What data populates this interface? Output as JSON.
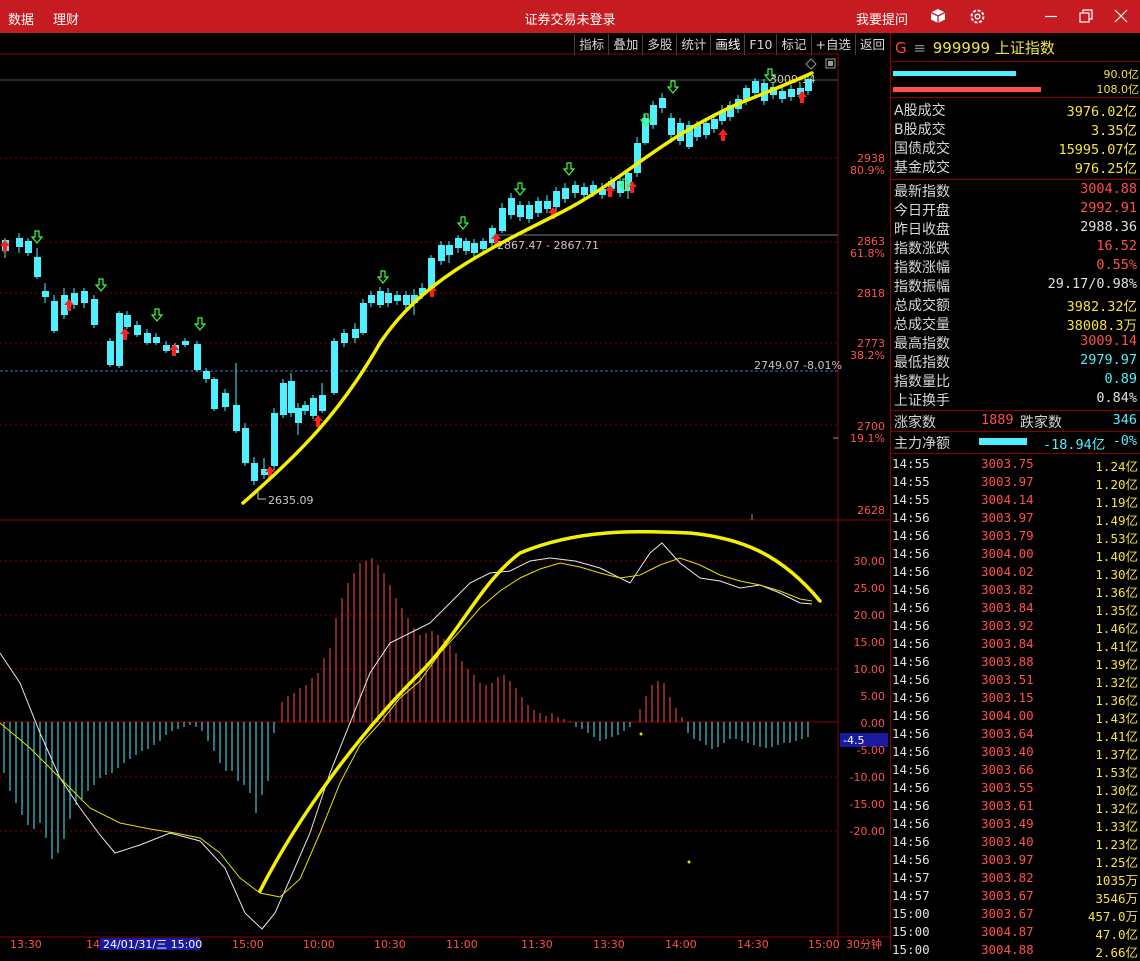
{
  "titlebar": {
    "menu": [
      "数据",
      "理财"
    ],
    "window_title": "证券交易未登录",
    "help_label": "我要提问",
    "icons": [
      "cube-icon",
      "gear-icon",
      "minimize-icon",
      "restore-icon",
      "close-icon"
    ]
  },
  "toolbar": [
    "指标",
    "叠加",
    "多股",
    "统计",
    "画线",
    "F10",
    "标记",
    "+自选",
    "返回"
  ],
  "chart": {
    "price_axis": [
      "2938",
      "80.9%",
      "2863",
      "61.8%",
      "2818",
      "2773",
      "38.2%",
      "2700",
      "19.1%",
      "2628"
    ],
    "macd_axis": [
      "30.00",
      "25.00",
      "20.00",
      "15.00",
      "10.00",
      "5.00",
      "0.00",
      "-4.5",
      "-5.00",
      "-10.00",
      "-15.00",
      "-20.00"
    ],
    "annotations": {
      "fib_range": "2867.47 - 2867.71",
      "fib_level": "2749.07 -8.01%",
      "low": "2635.09",
      "high": "3009.14"
    },
    "time_axis": [
      "13:30",
      "14",
      "24/01/31/三 15:00",
      "15:00",
      "10:00",
      "10:30",
      "11:00",
      "11:30",
      "13:30",
      "14:00",
      "14:30",
      "15:00",
      "30分钟"
    ],
    "colors": {
      "up": "#ff3c3c",
      "down": "#4ef0ff",
      "drawing": "#f5f000",
      "grid": "#8b0000"
    }
  },
  "panel": {
    "code": "999999",
    "name": "上证指数",
    "prefix": "G",
    "volume_bars": {
      "top": "90.0亿",
      "bottom": "108.0亿"
    },
    "rows1": [
      {
        "k": "A股成交",
        "v": "3976.02亿",
        "c": "#f5e342"
      },
      {
        "k": "B股成交",
        "v": "3.35亿",
        "c": "#f5e342"
      },
      {
        "k": "国债成交",
        "v": "15995.07亿",
        "c": "#f5e342"
      },
      {
        "k": "基金成交",
        "v": "976.25亿",
        "c": "#f5e342"
      }
    ],
    "rows2": [
      {
        "k": "最新指数",
        "v": "3004.88",
        "c": "#ff5050"
      },
      {
        "k": "今日开盘",
        "v": "2992.91",
        "c": "#ff5050"
      },
      {
        "k": "昨日收盘",
        "v": "2988.36",
        "c": "#e0e0e0"
      },
      {
        "k": "指数涨跌",
        "v": "16.52",
        "c": "#ff5050"
      },
      {
        "k": "指数涨幅",
        "v": "0.55%",
        "c": "#ff5050"
      },
      {
        "k": "指数振幅",
        "v": "29.17/0.98%",
        "c": "#e0e0e0"
      },
      {
        "k": "总成交额",
        "v": "3982.32亿",
        "c": "#f5e342"
      },
      {
        "k": "总成交量",
        "v": "38008.3万",
        "c": "#f5e342"
      },
      {
        "k": "最高指数",
        "v": "3009.14",
        "c": "#ff5050"
      },
      {
        "k": "最低指数",
        "v": "2979.97",
        "c": "#4ef0ff"
      },
      {
        "k": "指数量比",
        "v": "0.89",
        "c": "#4ef0ff"
      },
      {
        "k": "上证换手",
        "v": "0.84%",
        "c": "#e0e0e0"
      }
    ],
    "breadth": {
      "up_label": "涨家数",
      "up": "1889",
      "down_label": "跌家数",
      "down": "346"
    },
    "flow": {
      "label": "主力净额",
      "value": "-18.94亿",
      "pct": "-0%"
    },
    "ticks": [
      {
        "t": "14:55",
        "p": "3003.75",
        "v": "1.24亿"
      },
      {
        "t": "14:55",
        "p": "3003.97",
        "v": "1.20亿"
      },
      {
        "t": "14:55",
        "p": "3004.14",
        "v": "1.19亿"
      },
      {
        "t": "14:56",
        "p": "3003.97",
        "v": "1.49亿"
      },
      {
        "t": "14:56",
        "p": "3003.79",
        "v": "1.53亿"
      },
      {
        "t": "14:56",
        "p": "3004.00",
        "v": "1.40亿"
      },
      {
        "t": "14:56",
        "p": "3004.02",
        "v": "1.30亿"
      },
      {
        "t": "14:56",
        "p": "3003.82",
        "v": "1.36亿"
      },
      {
        "t": "14:56",
        "p": "3003.84",
        "v": "1.35亿"
      },
      {
        "t": "14:56",
        "p": "3003.92",
        "v": "1.46亿"
      },
      {
        "t": "14:56",
        "p": "3003.84",
        "v": "1.41亿"
      },
      {
        "t": "14:56",
        "p": "3003.88",
        "v": "1.39亿"
      },
      {
        "t": "14:56",
        "p": "3003.51",
        "v": "1.32亿"
      },
      {
        "t": "14:56",
        "p": "3003.15",
        "v": "1.36亿"
      },
      {
        "t": "14:56",
        "p": "3004.00",
        "v": "1.43亿"
      },
      {
        "t": "14:56",
        "p": "3003.64",
        "v": "1.41亿"
      },
      {
        "t": "14:56",
        "p": "3003.40",
        "v": "1.37亿"
      },
      {
        "t": "14:56",
        "p": "3003.66",
        "v": "1.53亿"
      },
      {
        "t": "14:56",
        "p": "3003.55",
        "v": "1.30亿"
      },
      {
        "t": "14:56",
        "p": "3003.61",
        "v": "1.32亿"
      },
      {
        "t": "14:56",
        "p": "3003.49",
        "v": "1.33亿"
      },
      {
        "t": "14:56",
        "p": "3003.40",
        "v": "1.23亿"
      },
      {
        "t": "14:56",
        "p": "3003.97",
        "v": "1.25亿"
      },
      {
        "t": "14:57",
        "p": "3003.82",
        "v": "1035万"
      },
      {
        "t": "14:57",
        "p": "3003.67",
        "v": "3546万"
      },
      {
        "t": "15:00",
        "p": "3003.67",
        "v": "457.0万"
      },
      {
        "t": "15:00",
        "p": "3004.87",
        "v": "47.0亿"
      },
      {
        "t": "15:00",
        "p": "3004.88",
        "v": "2.66亿"
      }
    ]
  }
}
